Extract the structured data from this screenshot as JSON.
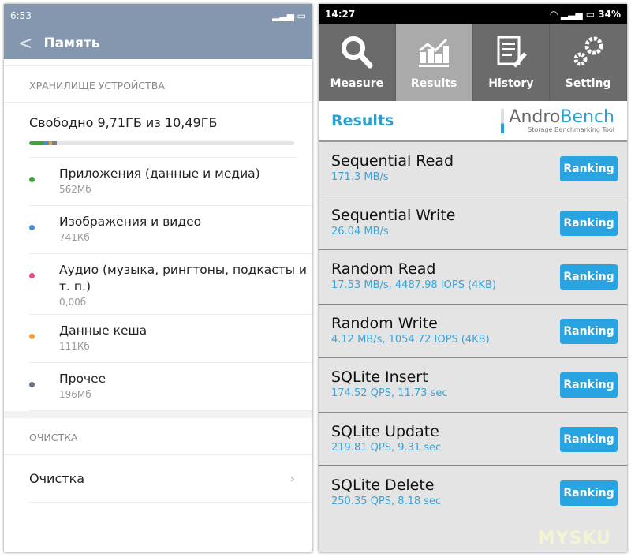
{
  "left": {
    "status": {
      "time": "6:53"
    },
    "title": "Память",
    "storage_header": "ХРАНИЛИЩЕ УСТРОЙСТВА",
    "free_text": "Свободно 9,71ГБ из 10,49ГБ",
    "usage_bar": [
      {
        "color": "#3aa63a",
        "fraction": 0.054
      },
      {
        "color": "#4a8fd8",
        "fraction": 0.02
      },
      {
        "color": "#f0a030",
        "fraction": 0.012
      },
      {
        "color": "#777f8a",
        "fraction": 0.018
      }
    ],
    "items": [
      {
        "title": "Приложения (данные и медиа)",
        "size": "562Мб",
        "color": "#3aa63a"
      },
      {
        "title": "Изображения и видео",
        "size": "741Кб",
        "color": "#4a8fd8"
      },
      {
        "title": "Аудио (музыка, рингтоны, подкасты и т. п.)",
        "size": "0,00б",
        "color": "#e84a8a"
      },
      {
        "title": "Данные кеша",
        "size": "111Кб",
        "color": "#f0a030"
      },
      {
        "title": "Прочее",
        "size": "196Мб",
        "color": "#6a7380"
      }
    ],
    "clean_header": "ОЧИСТКА",
    "clean_label": "Очистка"
  },
  "right": {
    "status": {
      "time": "14:27",
      "battery": "34%"
    },
    "tabs": [
      {
        "label": "Measure",
        "icon": "search-icon"
      },
      {
        "label": "Results",
        "icon": "chart-icon",
        "active": true
      },
      {
        "label": "History",
        "icon": "document-icon"
      },
      {
        "label": "Setting",
        "icon": "gears-icon"
      }
    ],
    "header_title": "Results",
    "logo": {
      "andro": "Andro",
      "bench": "Bench",
      "tagline": "Storage Benchmarking Tool"
    },
    "ranking_label": "Ranking",
    "results": [
      {
        "name": "Sequential Read",
        "value": "171.3 MB/s"
      },
      {
        "name": "Sequential Write",
        "value": "26.04 MB/s"
      },
      {
        "name": "Random Read",
        "value": "17.53 MB/s, 4487.98 IOPS (4KB)"
      },
      {
        "name": "Random Write",
        "value": "4.12 MB/s, 1054.72 IOPS (4KB)"
      },
      {
        "name": "SQLite Insert",
        "value": "174.52 QPS, 11.73 sec"
      },
      {
        "name": "SQLite Update",
        "value": "219.81 QPS, 9.31 sec"
      },
      {
        "name": "SQLite Delete",
        "value": "250.35 QPS, 8.18 sec"
      }
    ],
    "watermark": "MYSKU"
  }
}
